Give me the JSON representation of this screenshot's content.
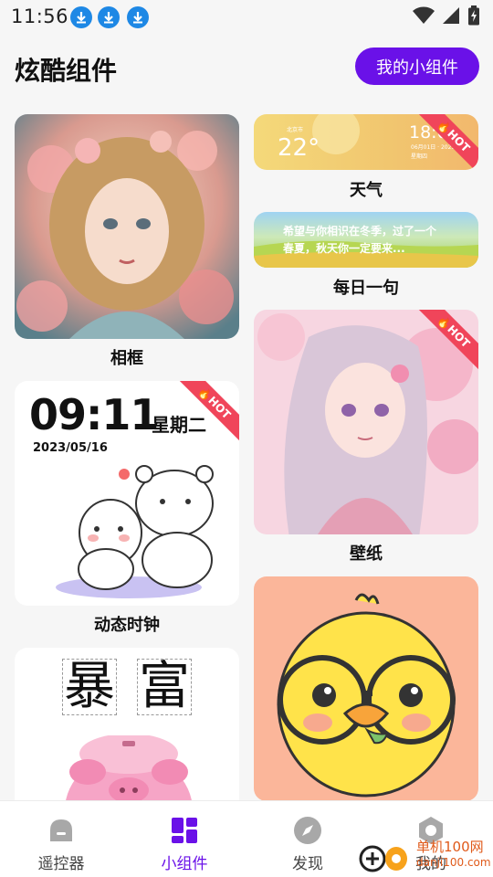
{
  "status_bar": {
    "time": "11:56",
    "download_icons": [
      "download-icon",
      "download-icon",
      "download-icon"
    ],
    "icons": [
      "wifi-icon",
      "signal-icon",
      "battery-charging-icon"
    ]
  },
  "header": {
    "title": "炫酷组件",
    "my_widgets_label": "我的小组件"
  },
  "widgets": {
    "photo_frame": {
      "label": "相框"
    },
    "weather": {
      "label": "天气",
      "temperature": "22°",
      "clock": "18:01",
      "location": "北京市",
      "date_small": "06月01日 · 2023",
      "day_small": "星期四",
      "hot": true
    },
    "daily_quote": {
      "label": "每日一句",
      "quote_line1": "希望与你相识在冬季，过了一个",
      "quote_line2": "春夏，秋天你一定要来..."
    },
    "wallpaper": {
      "label": "壁纸",
      "hot": true
    },
    "dynamic_clock": {
      "label": "动态时钟",
      "time": "09:11",
      "weekday": "星期二",
      "date": "2023/05/16",
      "hot": true
    },
    "calligraphy": {
      "chars": [
        "暴",
        "富"
      ]
    },
    "duck": {}
  },
  "hot_badge": "HOT",
  "bottom_nav": {
    "items": [
      {
        "label": "遥控器",
        "icon": "remote-icon"
      },
      {
        "label": "小组件",
        "icon": "widgets-icon"
      },
      {
        "label": "发现",
        "icon": "compass-icon"
      },
      {
        "label": "我的",
        "icon": "profile-icon"
      }
    ],
    "active_index": 1
  },
  "watermark": {
    "line1": "单机100网",
    "line2": "danji100.com"
  },
  "colors": {
    "accent": "#6a11e8",
    "hot": "#f0455a",
    "background": "#f6f6f6"
  }
}
